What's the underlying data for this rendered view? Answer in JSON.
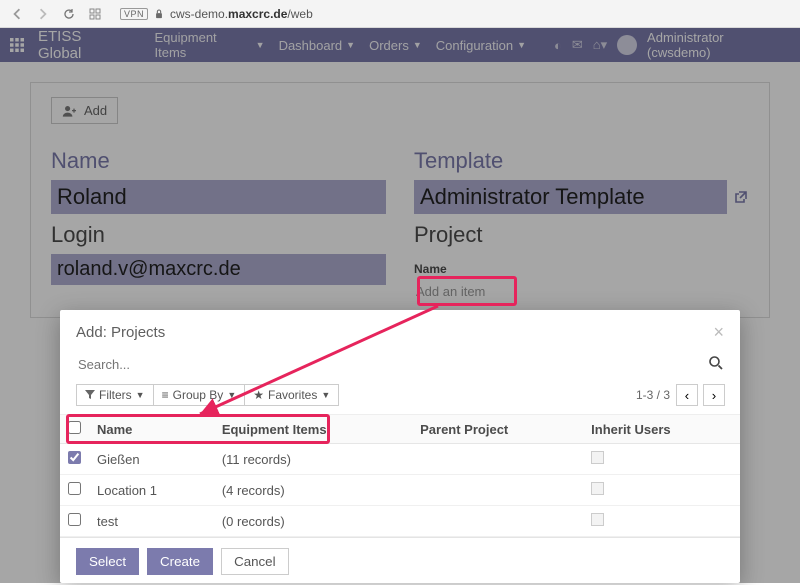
{
  "browser": {
    "vpn_badge": "VPN",
    "url_prefix": "cws-demo.",
    "url_host": "maxcrc.de",
    "url_path": "/web"
  },
  "nav": {
    "brand": "ETISS Global",
    "menu": [
      "Equipment Items",
      "Dashboard",
      "Orders",
      "Configuration"
    ],
    "user_label": "Administrator (cwsdemo)"
  },
  "page": {
    "add_button": "Add",
    "labels": {
      "name": "Name",
      "login": "Login",
      "template": "Template",
      "project": "Project",
      "project_col_name": "Name",
      "add_item_link": "Add an item"
    },
    "values": {
      "name": "Roland",
      "login": "roland.v@maxcrc.de",
      "template": "Administrator Template"
    }
  },
  "modal": {
    "title": "Add: Projects",
    "search_placeholder": "Search...",
    "toolbar": {
      "filters": "Filters",
      "group_by": "Group By",
      "favorites": "Favorites"
    },
    "pager": "1-3 / 3",
    "columns": {
      "name": "Name",
      "equipment": "Equipment Items",
      "parent": "Parent Project",
      "inherit": "Inherit Users"
    },
    "rows": [
      {
        "checked": true,
        "name": "Gießen",
        "equipment": "(11 records)",
        "parent": "",
        "inherit": false
      },
      {
        "checked": false,
        "name": "Location 1",
        "equipment": "(4 records)",
        "parent": "",
        "inherit": false
      },
      {
        "checked": false,
        "name": "test",
        "equipment": "(0 records)",
        "parent": "",
        "inherit": false
      }
    ],
    "buttons": {
      "select": "Select",
      "create": "Create",
      "cancel": "Cancel"
    }
  }
}
